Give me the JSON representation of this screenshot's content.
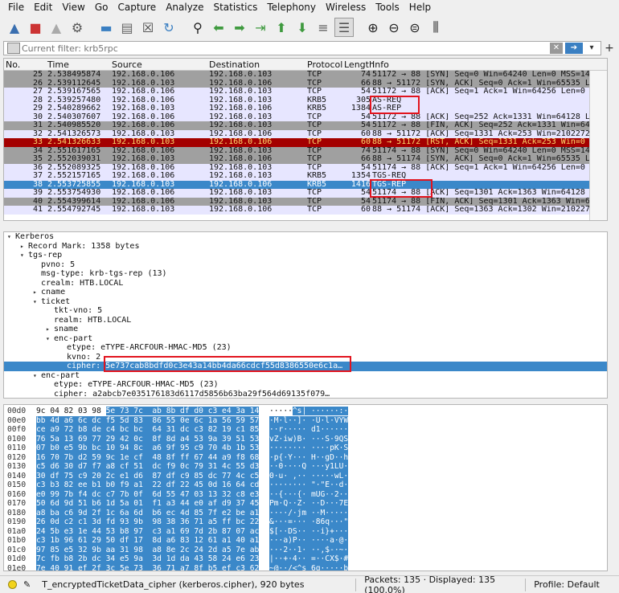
{
  "menu": [
    "File",
    "Edit",
    "View",
    "Go",
    "Capture",
    "Analyze",
    "Statistics",
    "Telephony",
    "Wireless",
    "Tools",
    "Help"
  ],
  "filter": {
    "placeholder": "Current filter: krb5rpc"
  },
  "columns": {
    "no": "No.",
    "time": "Time",
    "source": "Source",
    "destination": "Destination",
    "protocol": "Protocol",
    "length": "Length",
    "info": "Info"
  },
  "colors": {
    "tcp_gray": "#a0a0a0",
    "tcp_light": "#e7e6ff",
    "krb_light": "#e7e6ff",
    "rst_red": "#a40000",
    "selected_blue": "#3b88c9",
    "highlight_red": "#e2141e"
  },
  "packets": [
    {
      "no": "25",
      "time": "2.538495874",
      "src": "192.168.0.106",
      "dst": "192.168.0.103",
      "proto": "TCP",
      "len": "74",
      "info": "51172 → 88 [SYN] Seq=0 Win=64240 Len=0 MSS=146",
      "style": "gray"
    },
    {
      "no": "26",
      "time": "2.539112645",
      "src": "192.168.0.103",
      "dst": "192.168.0.106",
      "proto": "TCP",
      "len": "66",
      "info": "88 → 51172 [SYN, ACK] Seq=0 Ack=1 Win=65535 Le",
      "style": "gray"
    },
    {
      "no": "27",
      "time": "2.539167565",
      "src": "192.168.0.106",
      "dst": "192.168.0.103",
      "proto": "TCP",
      "len": "54",
      "info": "51172 → 88 [ACK] Seq=1 Ack=1 Win=64256 Len=0",
      "style": "light"
    },
    {
      "no": "28",
      "time": "2.539257480",
      "src": "192.168.0.106",
      "dst": "192.168.0.103",
      "proto": "KRB5",
      "len": "305",
      "info": "AS-REQ",
      "style": "light"
    },
    {
      "no": "29",
      "time": "2.540289662",
      "src": "192.168.0.103",
      "dst": "192.168.0.106",
      "proto": "KRB5",
      "len": "1384",
      "info": "AS-REP",
      "style": "light"
    },
    {
      "no": "30",
      "time": "2.540307607",
      "src": "192.168.0.106",
      "dst": "192.168.0.103",
      "proto": "TCP",
      "len": "54",
      "info": "51172 → 88 [ACK] Seq=252 Ack=1331 Win=64128 Le",
      "style": "light"
    },
    {
      "no": "31",
      "time": "2.540985520",
      "src": "192.168.0.106",
      "dst": "192.168.0.103",
      "proto": "TCP",
      "len": "54",
      "info": "51172 → 88 [FIN, ACK] Seq=252 Ack=1331 Win=641",
      "style": "gray"
    },
    {
      "no": "32",
      "time": "2.541326573",
      "src": "192.168.0.103",
      "dst": "192.168.0.106",
      "proto": "TCP",
      "len": "60",
      "info": "88 → 51172 [ACK] Seq=1331 Ack=253 Win=2102272",
      "style": "light"
    },
    {
      "no": "33",
      "time": "2.541326633",
      "src": "192.168.0.103",
      "dst": "192.168.0.106",
      "proto": "TCP",
      "len": "60",
      "info": "88 → 51172 [RST, ACK] Seq=1331 Ack=253 Win=0 L",
      "style": "red"
    },
    {
      "no": "34",
      "time": "2.551617165",
      "src": "192.168.0.106",
      "dst": "192.168.0.103",
      "proto": "TCP",
      "len": "74",
      "info": "51174 → 88 [SYN] Seq=0 Win=64240 Len=0 MSS=146",
      "style": "gray"
    },
    {
      "no": "35",
      "time": "2.552039031",
      "src": "192.168.0.103",
      "dst": "192.168.0.106",
      "proto": "TCP",
      "len": "66",
      "info": "88 → 51174 [SYN, ACK] Seq=0 Ack=1 Win=65535 Le",
      "style": "gray"
    },
    {
      "no": "36",
      "time": "2.552089325",
      "src": "192.168.0.106",
      "dst": "192.168.0.103",
      "proto": "TCP",
      "len": "54",
      "info": "51174 → 88 [ACK] Seq=1 Ack=1 Win=64256 Len=0",
      "style": "light"
    },
    {
      "no": "37",
      "time": "2.552157165",
      "src": "192.168.0.106",
      "dst": "192.168.0.103",
      "proto": "KRB5",
      "len": "1354",
      "info": "TGS-REQ",
      "style": "light"
    },
    {
      "no": "38",
      "time": "2.553725855",
      "src": "192.168.0.103",
      "dst": "192.168.0.106",
      "proto": "KRB5",
      "len": "1416",
      "info": "TGS-REP",
      "style": "selected"
    },
    {
      "no": "39",
      "time": "2.553754930",
      "src": "192.168.0.106",
      "dst": "192.168.0.103",
      "proto": "TCP",
      "len": "54",
      "info": "51174 → 88 [ACK] Seq=1301 Ack=1363 Win=64128 L",
      "style": "light"
    },
    {
      "no": "40",
      "time": "2.554399614",
      "src": "192.168.0.106",
      "dst": "192.168.0.103",
      "proto": "TCP",
      "len": "54",
      "info": "51174 → 88 [FIN, ACK] Seq=1301 Ack=1363 Win=64",
      "style": "gray"
    },
    {
      "no": "41",
      "time": "2.554792745",
      "src": "192.168.0.103",
      "dst": "192.168.0.106",
      "proto": "TCP",
      "len": "60",
      "info": "88 → 51174 [ACK] Seq=1363 Ack=1302 Win=2102272",
      "style": "light"
    }
  ],
  "details": [
    {
      "indent": 0,
      "arrow": "▾",
      "text": "Kerberos"
    },
    {
      "indent": 1,
      "arrow": "▸",
      "text": "Record Mark: 1358 bytes"
    },
    {
      "indent": 1,
      "arrow": "▾",
      "text": "tgs-rep"
    },
    {
      "indent": 2,
      "arrow": "",
      "text": "pvno: 5"
    },
    {
      "indent": 2,
      "arrow": "",
      "text": "msg-type: krb-tgs-rep (13)"
    },
    {
      "indent": 2,
      "arrow": "",
      "text": "crealm: HTB.LOCAL"
    },
    {
      "indent": 2,
      "arrow": "▸",
      "text": "cname"
    },
    {
      "indent": 2,
      "arrow": "▾",
      "text": "ticket"
    },
    {
      "indent": 3,
      "arrow": "",
      "text": "tkt-vno: 5"
    },
    {
      "indent": 3,
      "arrow": "",
      "text": "realm: HTB.LOCAL"
    },
    {
      "indent": 3,
      "arrow": "▸",
      "text": "sname"
    },
    {
      "indent": 3,
      "arrow": "▾",
      "text": "enc-part"
    },
    {
      "indent": 4,
      "arrow": "",
      "text": "etype: eTYPE-ARCFOUR-HMAC-MD5 (23)"
    },
    {
      "indent": 4,
      "arrow": "",
      "text": "kvno: 2"
    },
    {
      "indent": 4,
      "arrow": "",
      "text": "cipher: 5e737cab8bdfd0c3e43a14bb4da66cdcf55d8386550e6c1a…",
      "selected": true
    },
    {
      "indent": 2,
      "arrow": "▾",
      "text": "enc-part"
    },
    {
      "indent": 3,
      "arrow": "",
      "text": "etype: eTYPE-ARCFOUR-HMAC-MD5 (23)"
    },
    {
      "indent": 3,
      "arrow": "",
      "text": "cipher: a2abcb7e035176183d6117d5856b63ba29f564d69135f079…"
    }
  ],
  "bytes": [
    {
      "off": "00d0",
      "hex": "9c 04 82 03 98 5e 73 7c  ab 8b df d0 c3 e4 3a 14",
      "asc": "·····^s| ······:·",
      "hlstart": 5
    },
    {
      "off": "00e0",
      "hex": "bb 4d a6 6c dc f5 5d 83  86 55 0e 6c 1a 56 59 57",
      "asc": "·M·l··]· ·U·l·VYW"
    },
    {
      "off": "00f0",
      "hex": "ce a9 72 b8 de c4 bc bc  64 31 dc c3 82 19 c1 85",
      "asc": "··r····· d1······"
    },
    {
      "off": "0100",
      "hex": "76 5a 13 69 77 29 42 0c  8f 8d a4 53 9a 39 51 53",
      "asc": "vZ·iw)B· ···S·9QS"
    },
    {
      "off": "0110",
      "hex": "07 b0 e5 9b bc 10 94 8c  a6 9f 95 c9 70 4b 1b 53",
      "asc": "········ ····pK·S"
    },
    {
      "off": "0120",
      "hex": "16 70 7b d2 59 9c 1e cf  48 8f ff 67 44 a9 f8 68",
      "asc": "·p{·Y··· H··gD··h"
    },
    {
      "off": "0130",
      "hex": "c5 d6 30 d7 f7 a8 cf 51  dc f9 0c 79 31 4c 55 d3",
      "asc": "··0····Q ···y1LU·"
    },
    {
      "off": "0140",
      "hex": "30 df 75 c9 20 2c e1 d6  87 df c9 85 dc 77 4c c5",
      "asc": "0·u· ,·· ·····wL·"
    },
    {
      "off": "0150",
      "hex": "c3 b3 82 ee b1 b0 f9 a1  22 df 22 45 0d 16 64 cd",
      "asc": "········ \"·\"E··d·"
    },
    {
      "off": "0160",
      "hex": "e0 99 7b f4 dc c7 7b 0f  6d 55 47 03 13 32 c8 e3",
      "asc": "··{···{· mUG··2··"
    },
    {
      "off": "0170",
      "hex": "50 6d 9d 51 b6 1d 5a 01  f1 a3 44 e0 af d9 37 45",
      "asc": "Pm·Q··Z· ··D···7E"
    },
    {
      "off": "0180",
      "hex": "a8 ba c6 9d 2f 1c 6a 6d  b6 ec 4d 85 7f e2 be a1",
      "asc": "····/·jm ··M·····"
    },
    {
      "off": "0190",
      "hex": "26 0d c2 c1 3d fd 93 9b  98 38 36 71 a5 ff bc 22",
      "asc": "&···=··· ·86q···\""
    },
    {
      "off": "01a0",
      "hex": "24 5b e3 1e 44 53 b8 97  c3 a1 69 7d 2b 87 07 ac",
      "asc": "$[··DS·· ··i}+···"
    },
    {
      "off": "01b0",
      "hex": "c3 1b 96 61 29 50 df 17  8d a6 83 12 61 a1 40 a1",
      "asc": "···a)P·· ····a·@·"
    },
    {
      "off": "01c0",
      "hex": "97 85 e5 32 9b aa 31 98  a8 8e 2c 24 2d a5 7e ab",
      "asc": "···2··1· ··,$-·~·"
    },
    {
      "off": "01d0",
      "hex": "7c fb b8 2b dc 34 e5 9a  3d 1d da 43 58 24 e6 23",
      "asc": "|··+·4·· =··CX$·#"
    },
    {
      "off": "01e0",
      "hex": "7e 40 91 ef 2f 3c 5e 73  36 71 a7 8f b5 ef c3 62",
      "asc": "~@··/<^s 6q·····b"
    }
  ],
  "status": {
    "field": "T_encryptedTicketData_cipher (kerberos.cipher), 920 bytes",
    "packets": "Packets: 135 · Displayed: 135 (100.0%)",
    "profile": "Profile: Default"
  }
}
